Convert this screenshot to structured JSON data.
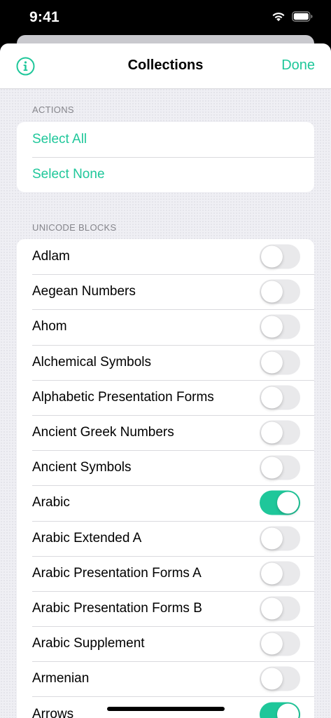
{
  "status_bar": {
    "time": "9:41",
    "icons": [
      "wifi-icon",
      "battery-icon"
    ]
  },
  "navbar": {
    "title": "Collections",
    "done_label": "Done",
    "info_icon": "info-circle-icon"
  },
  "colors": {
    "accent": "#1fc79a",
    "toggle_off": "#e9e9eb",
    "background": "#efeff4"
  },
  "actions": {
    "header": "ACTIONS",
    "items": [
      {
        "label": "Select All"
      },
      {
        "label": "Select None"
      }
    ]
  },
  "unicode_blocks": {
    "header": "UNICODE BLOCKS",
    "items": [
      {
        "label": "Adlam",
        "enabled": false
      },
      {
        "label": "Aegean Numbers",
        "enabled": false
      },
      {
        "label": "Ahom",
        "enabled": false
      },
      {
        "label": "Alchemical Symbols",
        "enabled": false
      },
      {
        "label": "Alphabetic Presentation Forms",
        "enabled": false
      },
      {
        "label": "Ancient Greek Numbers",
        "enabled": false
      },
      {
        "label": "Ancient Symbols",
        "enabled": false
      },
      {
        "label": "Arabic",
        "enabled": true
      },
      {
        "label": "Arabic Extended A",
        "enabled": false
      },
      {
        "label": "Arabic Presentation Forms A",
        "enabled": false
      },
      {
        "label": "Arabic Presentation Forms B",
        "enabled": false
      },
      {
        "label": "Arabic Supplement",
        "enabled": false
      },
      {
        "label": "Armenian",
        "enabled": false
      },
      {
        "label": "Arrows",
        "enabled": true
      }
    ]
  }
}
